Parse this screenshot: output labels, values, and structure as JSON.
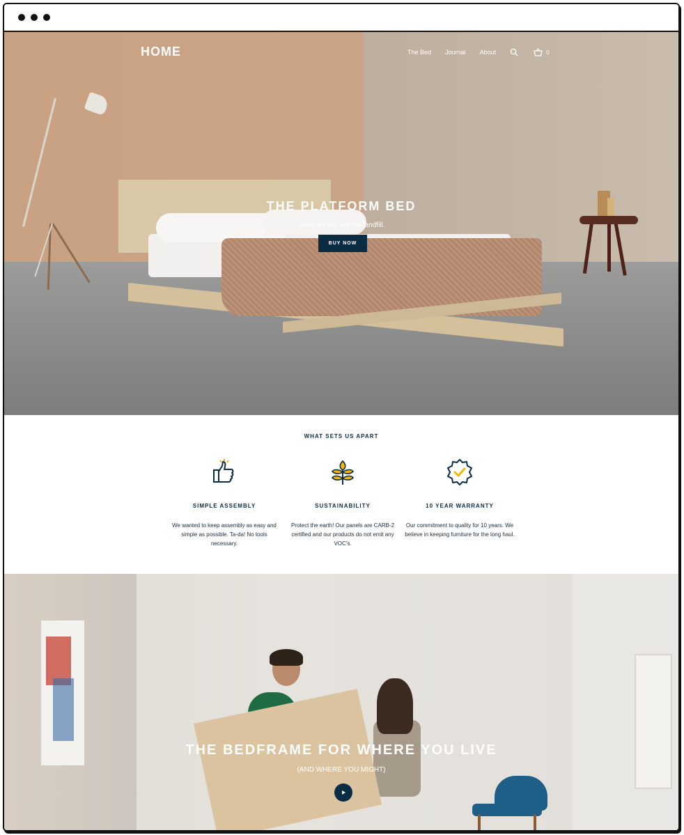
{
  "nav": {
    "logo": "HOME",
    "links": [
      "The Bed",
      "Journal",
      "About"
    ],
    "search_icon": "search-icon",
    "cart_icon": "basket-icon",
    "cart_count": "0"
  },
  "hero": {
    "title": "THE PLATFORM BED",
    "subtitle": "Made for life, not the landfill.",
    "button": "BUY NOW"
  },
  "features": {
    "section_title": "WHAT SETS US APART",
    "items": [
      {
        "icon": "thumbs-up-icon",
        "title": "SIMPLE ASSEMBLY",
        "text": "We wanted to keep assembly as easy and simple as possible. Ta-da! No tools necessary."
      },
      {
        "icon": "leaf-icon",
        "title": "SUSTAINABILITY",
        "text": "Protect the earth! Our panels are CARB-2 certified and our products do not emit any VOC's."
      },
      {
        "icon": "badge-check-icon",
        "title": "10 YEAR WARRANTY",
        "text": "Our commitment to quality for 10 years. We believe in keeping furniture for the long haul."
      }
    ]
  },
  "hero2": {
    "title": "THE BEDFRAME FOR WHERE YOU LIVE",
    "subtitle": "(AND WHERE YOU MIGHT)",
    "play_icon": "play-icon"
  },
  "colors": {
    "navy": "#0b2c45",
    "accent_yellow": "#f2b705"
  }
}
